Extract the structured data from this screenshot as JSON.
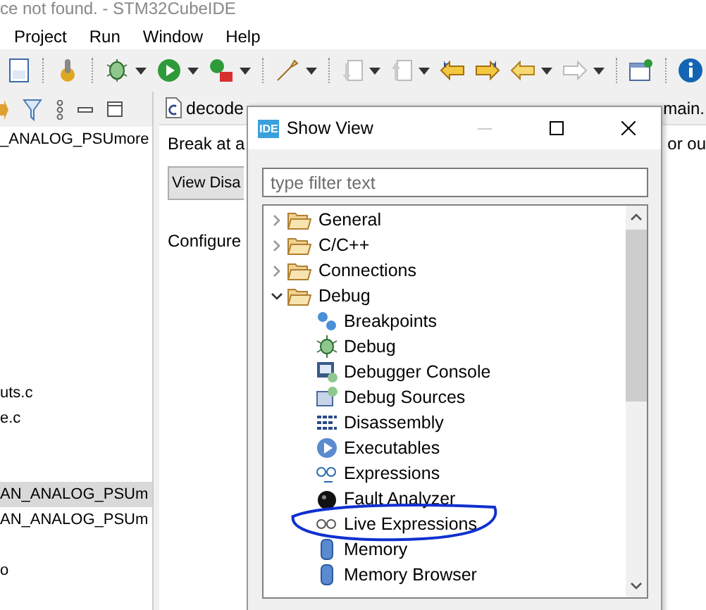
{
  "window": {
    "title": "ce not found. - STM32CubeIDE"
  },
  "menu": [
    "Project",
    "Run",
    "Window",
    "Help"
  ],
  "project_explorer": {
    "items": [
      {
        "label": "_ANALOG_PSUmore",
        "selected": false
      },
      {
        "label": "uts.c",
        "selected": false
      },
      {
        "label": "e.c",
        "selected": false
      },
      {
        "label": "AN_ANALOG_PSUm",
        "selected": true
      },
      {
        "label": "AN_ANALOG_PSUm",
        "selected": false
      },
      {
        "label": "o",
        "selected": false
      }
    ]
  },
  "editor": {
    "tabs": [
      {
        "label": "decode"
      },
      {
        "label": "main."
      }
    ],
    "text_left": "Break at a",
    "text_right": "or ou",
    "button": "View Disa",
    "configure": "Configure"
  },
  "dialog": {
    "logo": "IDE",
    "title": "Show View",
    "filter": {
      "placeholder": "type filter text"
    },
    "tree": [
      {
        "label": "General",
        "expanded": false
      },
      {
        "label": "C/C++",
        "expanded": false
      },
      {
        "label": "Connections",
        "expanded": false
      },
      {
        "label": "Debug",
        "expanded": true,
        "children": [
          {
            "label": "Breakpoints"
          },
          {
            "label": "Debug"
          },
          {
            "label": "Debugger Console"
          },
          {
            "label": "Debug Sources"
          },
          {
            "label": "Disassembly"
          },
          {
            "label": "Executables"
          },
          {
            "label": "Expressions"
          },
          {
            "label": "Fault Analyzer"
          },
          {
            "label": "Live Expressions"
          },
          {
            "label": "Memory"
          },
          {
            "label": "Memory Browser"
          }
        ]
      }
    ]
  }
}
